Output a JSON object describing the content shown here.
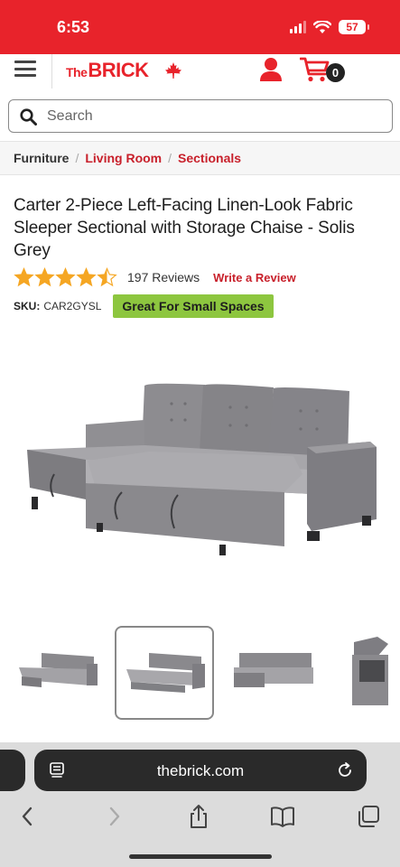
{
  "status_bar": {
    "time": "6:53",
    "battery": "57"
  },
  "header": {
    "logo_prefix": "The",
    "logo_main": "BRICK",
    "cart_count": "0"
  },
  "search": {
    "placeholder": "Search"
  },
  "breadcrumb": [
    {
      "label": "Furniture"
    },
    {
      "label": "Living Room"
    },
    {
      "label": "Sectionals"
    }
  ],
  "breadcrumb_sep": "/",
  "product": {
    "title": "Carter 2-Piece Left-Facing Linen-Look Fabric Sleeper Sectional with Storage Chaise - Solis Grey",
    "rating": 4.5,
    "rating_max": 5,
    "review_count": "197 Reviews",
    "write_review": "Write a Review",
    "sku_label": "SKU:",
    "sku_value": "CAR2GYSL",
    "badge": "Great For Small Spaces"
  },
  "gallery": {
    "thumbnail_count": 4,
    "active_index": 1
  },
  "browser": {
    "url": "thebrick.com"
  },
  "colors": {
    "brand_red": "#e8232b",
    "link_red": "#c8202b",
    "badge_green": "#8dc63f",
    "star_gold": "#f5a623"
  },
  "icons": [
    "hamburger-icon",
    "maple-leaf-icon",
    "account-icon",
    "cart-icon",
    "search-icon",
    "star-icon",
    "page-menu-icon",
    "reload-icon",
    "back-icon",
    "forward-icon",
    "share-icon",
    "bookmarks-icon",
    "tabs-icon"
  ]
}
